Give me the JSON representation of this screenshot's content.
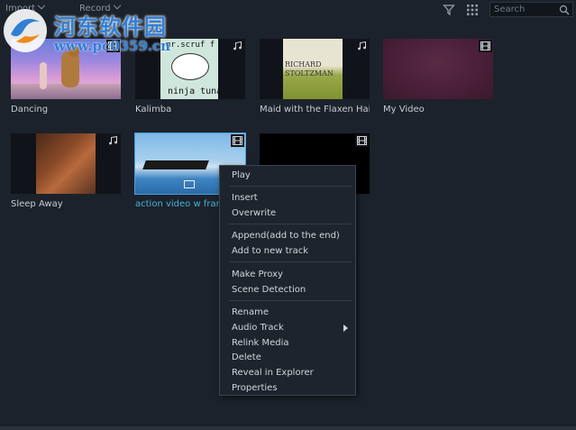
{
  "toolbar": {
    "import_label": "Import",
    "record_label": "Record",
    "search_placeholder": "Search"
  },
  "watermark": {
    "title": "河东软件园",
    "url": "www.pc0359.cn"
  },
  "media": [
    {
      "label": "Dancing",
      "type": "video",
      "thumb_text": ""
    },
    {
      "label": "Kalimba",
      "type": "audio",
      "thumb_text_top": "mr.scruf f",
      "thumb_text_bottom": "ninja tuna"
    },
    {
      "label": "Maid with the Flaxen Hair",
      "type": "audio",
      "thumb_text_top": "RICHARD",
      "thumb_text_bottom": "STOLTZMAN"
    },
    {
      "label": "My Video",
      "type": "video",
      "thumb_text": ""
    },
    {
      "label": "Sleep Away",
      "type": "audio",
      "thumb_text": ""
    },
    {
      "label": "action video w frame",
      "type": "video",
      "thumb_text": ""
    },
    {
      "label": "",
      "type": "video",
      "thumb_text": ""
    }
  ],
  "context_menu": {
    "items": [
      "Play",
      "Insert",
      "Overwrite",
      "Append(add to the end)",
      "Add to new track",
      "Make Proxy",
      "Scene Detection",
      "Rename",
      "Audio Track",
      "Relink Media",
      "Delete",
      "Reveal in Explorer",
      "Properties"
    ]
  },
  "colors": {
    "background": "#1c222c",
    "selected_label": "#43b3d4",
    "selected_border": "#4a9fd8",
    "menu_bg": "#1e242e"
  },
  "icons": {
    "filter": "filter-icon",
    "grid": "grid-view-icon",
    "search": "search-icon",
    "video_badge": "film-icon",
    "audio_badge": "music-note-icon",
    "submenu": "submenu-arrow-icon"
  }
}
